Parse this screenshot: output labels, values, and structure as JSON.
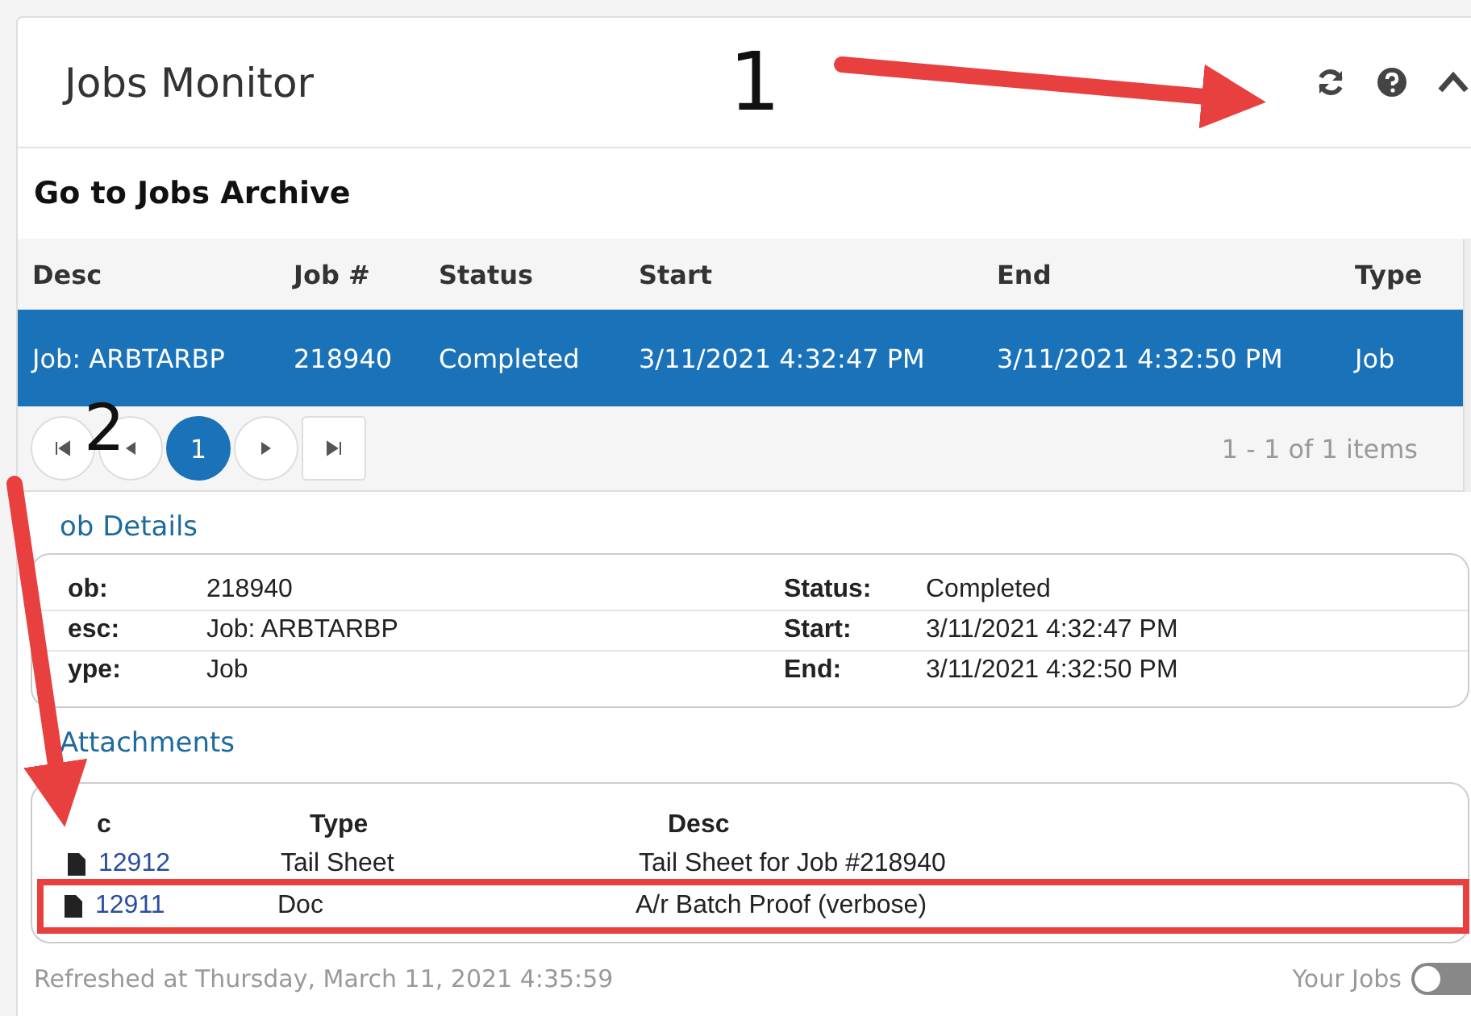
{
  "panel": {
    "title": "Jobs Monitor"
  },
  "archive_link": "Go to Jobs Archive",
  "jobs_table": {
    "columns": [
      "Desc",
      "Job #",
      "Status",
      "Start",
      "End",
      "Type"
    ],
    "rows": [
      {
        "cells": [
          "Job: ARBTARBP",
          "218940",
          "Completed",
          "3/11/2021 4:32:47 PM",
          "3/11/2021 4:32:50 PM",
          "Job"
        ],
        "selected": true
      }
    ]
  },
  "pager": {
    "pages": [
      {
        "label": "1",
        "selected": true
      }
    ],
    "summary": "1 - 1 of 1 items"
  },
  "job_details": {
    "title": "ob Details",
    "rows": [
      [
        {
          "label": "ob:",
          "value": "218940"
        },
        {
          "label": "Status:",
          "value": "Completed"
        }
      ],
      [
        {
          "label": "esc:",
          "value": "Job: ARBTARBP"
        },
        {
          "label": "Start:",
          "value": "3/11/2021 4:32:47 PM"
        }
      ],
      [
        {
          "label": "ype:",
          "value": "Job"
        },
        {
          "label": "End:",
          "value": "3/11/2021 4:32:50 PM"
        }
      ]
    ]
  },
  "attachments": {
    "title": "Attachments",
    "columns": [
      "c",
      "Type",
      "Desc"
    ],
    "rows": [
      {
        "doc": "12912",
        "type": "Tail Sheet",
        "desc": "Tail Sheet for Job #218940",
        "highlighted": false
      },
      {
        "doc": "12911",
        "type": "Doc",
        "desc": "A/r Batch Proof (verbose)",
        "highlighted": true
      }
    ]
  },
  "footer": {
    "refreshed": "Refreshed at Thursday, March 11, 2021 4:35:59",
    "toggle": {
      "label": "Your Jobs",
      "on": false
    }
  },
  "annotations": [
    {
      "label": "1"
    },
    {
      "label": "2"
    }
  ]
}
